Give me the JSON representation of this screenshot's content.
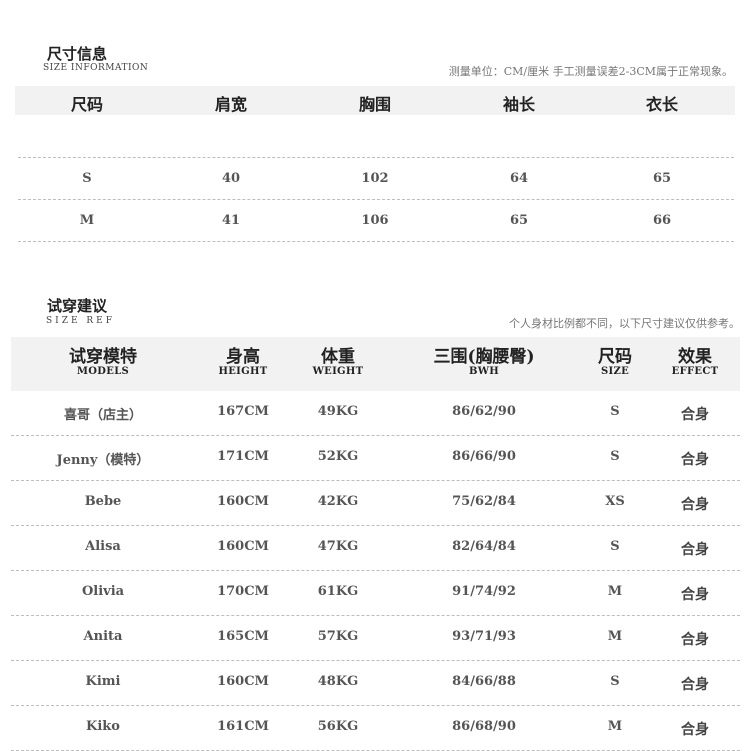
{
  "size_info": {
    "title": "尺寸信息",
    "subtitle": "SIZE INFORMATION",
    "note": "测量单位：CM/厘米  手工测量误差2-3CM属于正常现象。",
    "columns": [
      "尺码",
      "肩宽",
      "胸围",
      "袖长",
      "衣长"
    ],
    "rows": [
      [
        "S",
        "40",
        "102",
        "64",
        "65"
      ],
      [
        "M",
        "41",
        "106",
        "65",
        "66"
      ]
    ]
  },
  "size_ref": {
    "title": "试穿建议",
    "subtitle": "SIZE REF",
    "note": "个人身材比例都不同，以下尺寸建议仅供参考。",
    "columns": [
      {
        "cn": "试穿模特",
        "en": "MODELS"
      },
      {
        "cn": "身高",
        "en": "HEIGHT"
      },
      {
        "cn": "体重",
        "en": "WEIGHT"
      },
      {
        "cn": "三围(胸腰臀)",
        "en": "BWH"
      },
      {
        "cn": "尺码",
        "en": "SIZE"
      },
      {
        "cn": "效果",
        "en": "EFFECT"
      }
    ],
    "rows": [
      [
        "喜哥（店主）",
        "167CM",
        "49KG",
        "86/62/90",
        "S",
        "合身"
      ],
      [
        "Jenny（模特）",
        "171CM",
        "52KG",
        "86/66/90",
        "S",
        "合身"
      ],
      [
        "Bebe",
        "160CM",
        "42KG",
        "75/62/84",
        "XS",
        "合身"
      ],
      [
        "Alisa",
        "160CM",
        "47KG",
        "82/64/84",
        "S",
        "合身"
      ],
      [
        "Olivia",
        "170CM",
        "61KG",
        "91/74/92",
        "M",
        "合身"
      ],
      [
        "Anita",
        "165CM",
        "57KG",
        "93/71/93",
        "M",
        "合身"
      ],
      [
        "Kimi",
        "160CM",
        "48KG",
        "84/66/88",
        "S",
        "合身"
      ],
      [
        "Kiko",
        "161CM",
        "56KG",
        "86/68/90",
        "M",
        "合身"
      ]
    ]
  }
}
